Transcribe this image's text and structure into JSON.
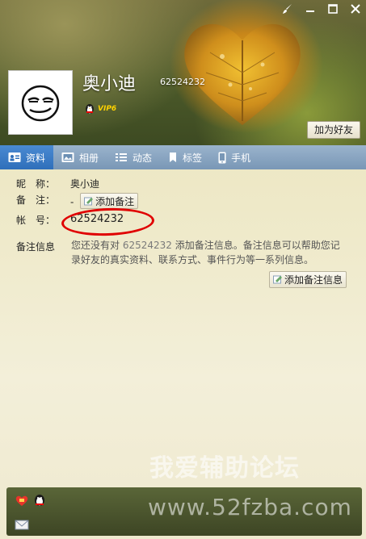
{
  "window": {
    "buttons": [
      "skin",
      "minimize",
      "maximize",
      "close"
    ]
  },
  "profile": {
    "display_name": "奥小迪",
    "qq_number": "62524232",
    "vip_label": "VIP6",
    "add_friend_label": "加为好友"
  },
  "tabs": [
    {
      "label": "资料",
      "icon": "profile-card-icon",
      "active": true
    },
    {
      "label": "相册",
      "icon": "album-icon",
      "active": false
    },
    {
      "label": "动态",
      "icon": "feed-list-icon",
      "active": false
    },
    {
      "label": "标签",
      "icon": "bookmark-tag-icon",
      "active": false
    },
    {
      "label": "手机",
      "icon": "phone-icon",
      "active": false
    }
  ],
  "info": {
    "nickname_label": "昵　称：",
    "nickname_value": "奥小迪",
    "remark_label": "备　注：",
    "remark_value": "-",
    "add_remark_btn": "添加备注",
    "account_label": "帐　号：",
    "account_value": "62524232",
    "remark_info_label": "备注信息",
    "remark_info_text_1": "您还没有对 ",
    "remark_info_num": "62524232",
    "remark_info_text_2": " 添加备注信息。备注信息可以帮助您记录好友的真实资料、联系方式、事件行为等一系列信息。",
    "add_remark_info_btn": "添加备注信息"
  },
  "watermark": {
    "line1": "我爱辅助论坛",
    "line2": "www.52fzba.com"
  },
  "colors": {
    "tab_active": "#2f6fba",
    "highlight_circle": "#e00000",
    "vip": "#ffd200"
  }
}
